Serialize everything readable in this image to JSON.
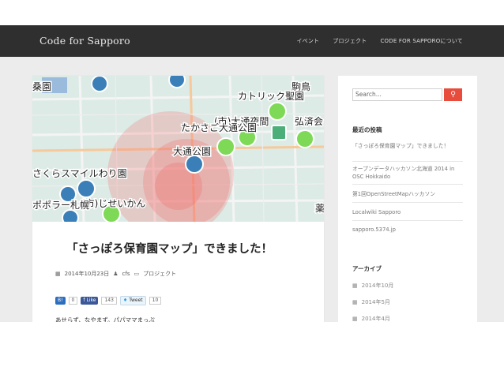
{
  "site": {
    "title": "Code for Sapporo"
  },
  "nav": {
    "items": [
      "イベント",
      "プロジェクト",
      "CODE FOR SAPPOROについて"
    ]
  },
  "map": {
    "labels": [
      "駒鳥",
      "カトリック聖園",
      "(市)大通夜間",
      "弘済会",
      "たかさご大通公園",
      "大通公園",
      "さくらスマイルわり園",
      "(市)じせいかん",
      "ポポラー札幌",
      "桑園",
      "薬"
    ]
  },
  "post": {
    "title": "「さっぽろ保育園マップ」できました！",
    "date": "2014年10月23日",
    "author": "cfs",
    "category": "プロジェクト",
    "social": {
      "hatena_count": "0",
      "like_label": "Like",
      "like_count": "143",
      "tweet_label": "Tweet",
      "tweet_count": "10"
    },
    "excerpt": "あせらず、なやまず。パパママまっぷ"
  },
  "sidebar": {
    "search_placeholder": "Search...",
    "recent_title": "最近の投稿",
    "recent_posts": [
      "「さっぽろ保育園マップ」できました！",
      "オープンデータハッカソン北海道 2014 in OSC Hokkaido",
      "第1回OpenStreetMapハッカソン",
      "Localwiki Sapporo",
      "sapporo.5374.jp"
    ],
    "archive_title": "アーカイブ",
    "archives": [
      "2014年10月",
      "2014年5月",
      "2014年4月"
    ]
  },
  "colors": {
    "navbar": "#2f2f2f",
    "accent": "#e74c3c",
    "marker_green": "#7ed957",
    "marker_blue": "#3a7fb8"
  }
}
